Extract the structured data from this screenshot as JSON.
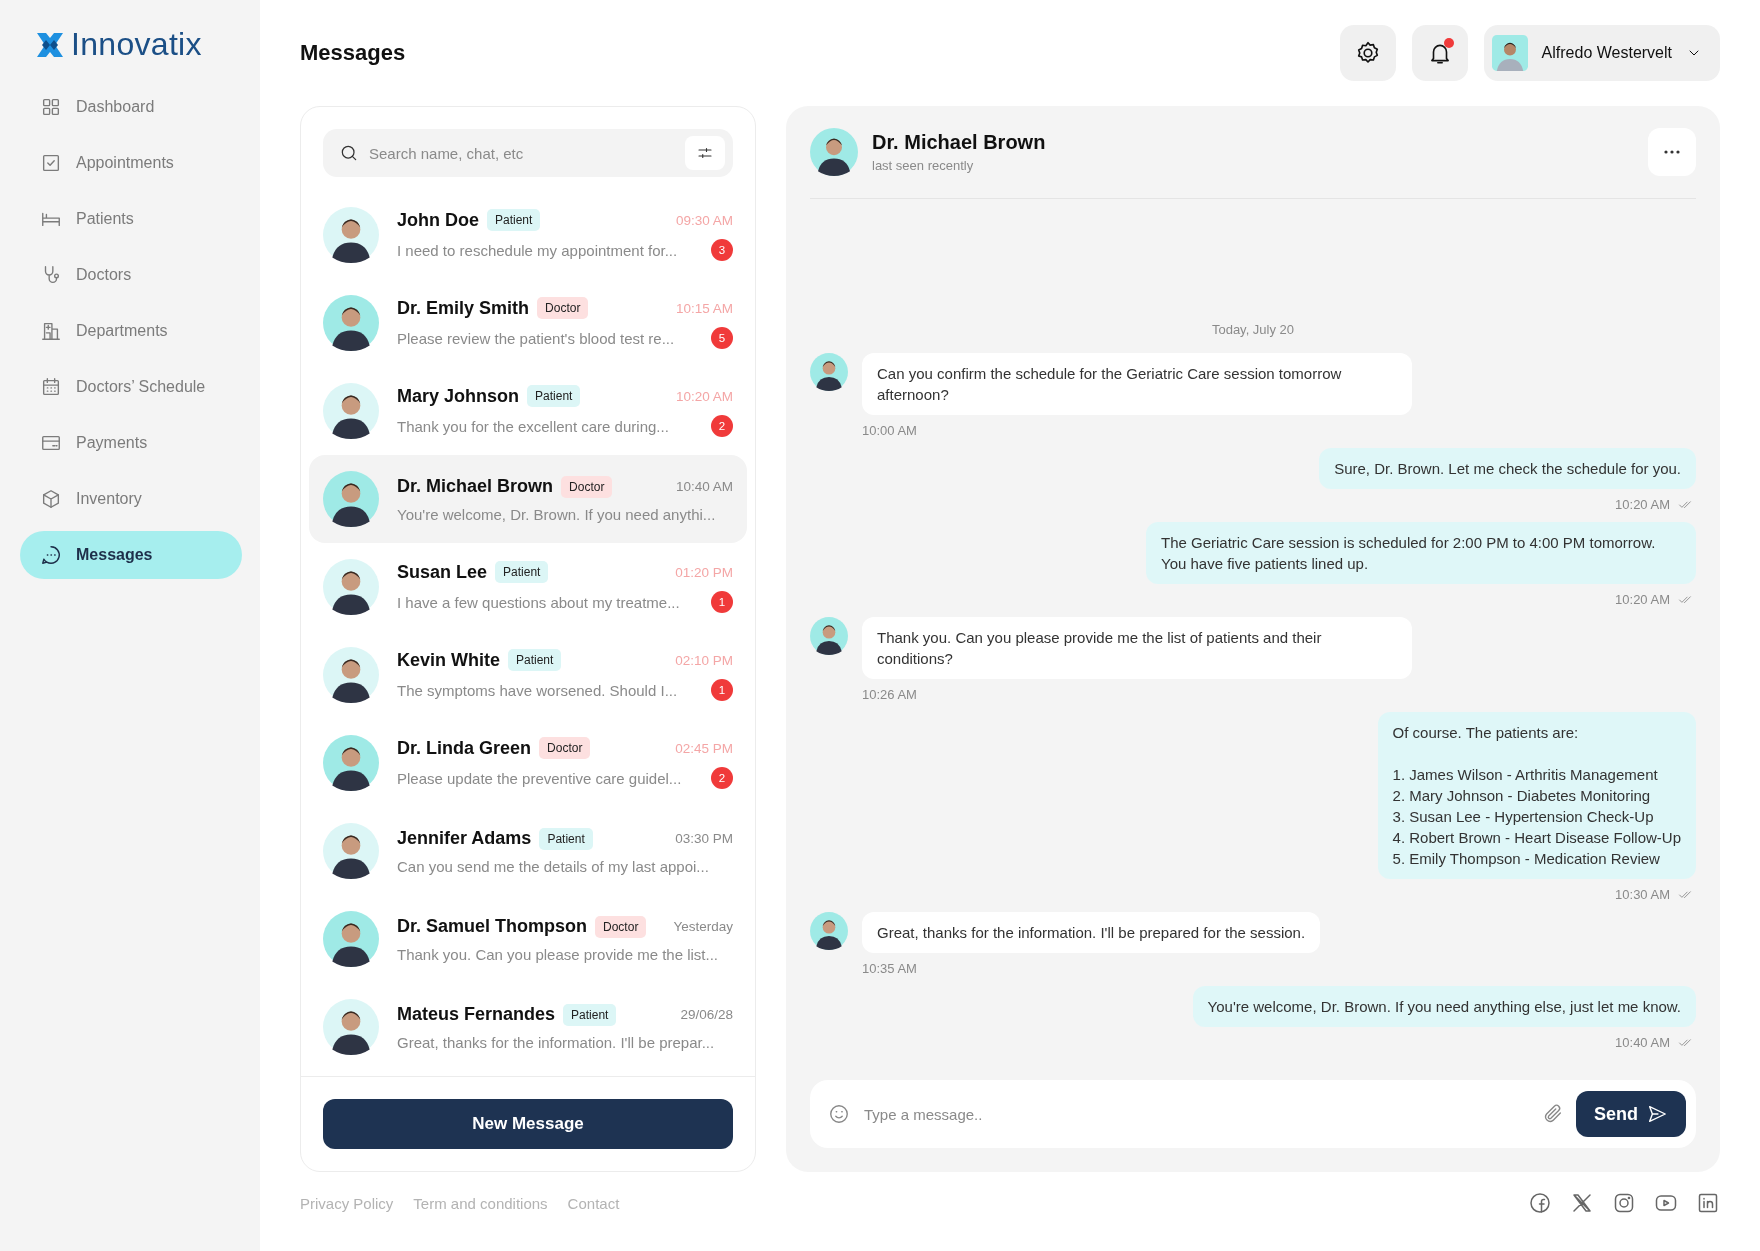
{
  "sidebar": {
    "logo": "Innovatix",
    "items": [
      {
        "label": "Dashboard",
        "selected": false
      },
      {
        "label": "Appointments",
        "selected": false
      },
      {
        "label": "Patients",
        "selected": false
      },
      {
        "label": "Doctors",
        "selected": false
      },
      {
        "label": "Departments",
        "selected": false
      },
      {
        "label": "Doctors’ Schedule",
        "selected": false
      },
      {
        "label": "Payments",
        "selected": false
      },
      {
        "label": "Inventory",
        "selected": false
      },
      {
        "label": "Messages",
        "selected": true
      }
    ]
  },
  "header": {
    "title": "Messages",
    "notifications": {
      "unread": true
    },
    "user": {
      "name": "Alfredo Westervelt"
    }
  },
  "contacts": {
    "search": {
      "placeholder": "Search name, chat, etc"
    },
    "items": [
      {
        "name": "John Doe",
        "role": "Patient",
        "kind": "patient",
        "time": "09:30 AM",
        "preview": "I need to reschedule my appointment for...",
        "unread": true,
        "badge": "3",
        "selected": false
      },
      {
        "name": "Dr. Emily Smith",
        "role": "Doctor",
        "kind": "doctor",
        "time": "10:15 AM",
        "preview": "Please review the patient's blood test re...",
        "unread": true,
        "badge": "5",
        "selected": false
      },
      {
        "name": "Mary Johnson",
        "role": "Patient",
        "kind": "patient",
        "time": "10:20 AM",
        "preview": "Thank you for the excellent care during...",
        "unread": true,
        "badge": "2",
        "selected": false
      },
      {
        "name": "Dr. Michael Brown",
        "role": "Doctor",
        "kind": "doctor",
        "time": "10:40 AM",
        "preview": "You're welcome, Dr. Brown. If you need anythi...",
        "unread": false,
        "selected": true
      },
      {
        "name": "Susan Lee",
        "role": "Patient",
        "kind": "patient",
        "time": "01:20 PM",
        "preview": "I have a few questions about my treatme...",
        "unread": true,
        "badge": "1",
        "selected": false
      },
      {
        "name": "Kevin White",
        "role": "Patient",
        "kind": "patient",
        "time": "02:10 PM",
        "preview": "The symptoms have worsened. Should I...",
        "unread": true,
        "badge": "1",
        "selected": false
      },
      {
        "name": "Dr. Linda Green",
        "role": "Doctor",
        "kind": "doctor",
        "time": "02:45 PM",
        "preview": "Please update the preventive care guidel...",
        "unread": true,
        "badge": "2",
        "selected": false
      },
      {
        "name": "Jennifer Adams",
        "role": "Patient",
        "kind": "patient",
        "time": "03:30 PM",
        "preview": "Can you send me the details of my last appoi...",
        "unread": false,
        "selected": false
      },
      {
        "name": "Dr. Samuel Thompson",
        "role": "Doctor",
        "kind": "doctor",
        "time": "Yesterday",
        "preview": "Thank you. Can you please provide me the list...",
        "unread": false,
        "selected": false
      },
      {
        "name": "Mateus Fernandes",
        "role": "Patient",
        "kind": "patient",
        "time": "29/06/28",
        "preview": "Great, thanks for the information. I'll be prepar...",
        "unread": false,
        "selected": false
      }
    ],
    "new_button": "New Message"
  },
  "chat": {
    "name": "Dr. Michael Brown",
    "status": "last seen recently",
    "date": "Today, July 20",
    "messages": [
      {
        "kind": "received",
        "text": "Can you confirm the schedule for the Geriatric Care session tomorrow afternoon?",
        "time": "10:00 AM"
      },
      {
        "kind": "sent",
        "text": "Sure, Dr. Brown. Let me check the schedule for you.",
        "time": "10:20 AM",
        "read": true
      },
      {
        "kind": "sent",
        "text": "The Geriatric Care session is scheduled for 2:00 PM to 4:00 PM tomorrow. You have five patients lined up.",
        "time": "10:20 AM",
        "read": true
      },
      {
        "kind": "received",
        "text": "Thank you. Can you please provide me the list of patients and their conditions?",
        "time": "10:26 AM"
      },
      {
        "kind": "sent",
        "text": "Of course. The patients are:\n\n1. James Wilson - Arthritis Management\n2. Mary Johnson - Diabetes Monitoring\n3. Susan Lee - Hypertension Check-Up\n4. Robert Brown - Heart Disease Follow-Up\n5. Emily Thompson - Medication Review",
        "time": "10:30 AM",
        "read": true
      },
      {
        "kind": "received",
        "text": "Great, thanks for the information. I'll be prepared for the session.",
        "time": "10:35 AM"
      },
      {
        "kind": "sent",
        "text": "You're welcome, Dr. Brown. If you need anything else, just let me know.",
        "time": "10:40 AM",
        "read": true
      }
    ],
    "composer": {
      "placeholder": "Type a message..",
      "send": "Send"
    }
  },
  "footer": {
    "links": [
      "Privacy Policy",
      "Term and conditions",
      "Contact"
    ]
  }
}
